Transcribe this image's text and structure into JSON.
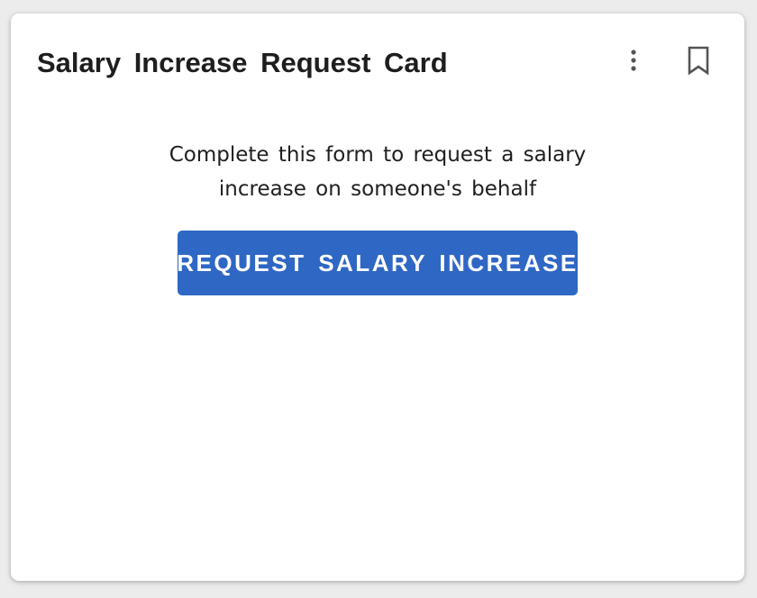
{
  "card": {
    "title": "Salary Increase Request Card",
    "more_icon": "more-vertical-icon",
    "bookmark_icon": "bookmark-icon",
    "description": "Complete this form to request a salary increase on someone's behalf",
    "button_label": "REQUEST SALARY INCREASE"
  },
  "colors": {
    "accent": "#2f67c4",
    "background": "#ececec",
    "card": "#ffffff",
    "title_text": "#1e1e1e",
    "icon": "#555555"
  }
}
